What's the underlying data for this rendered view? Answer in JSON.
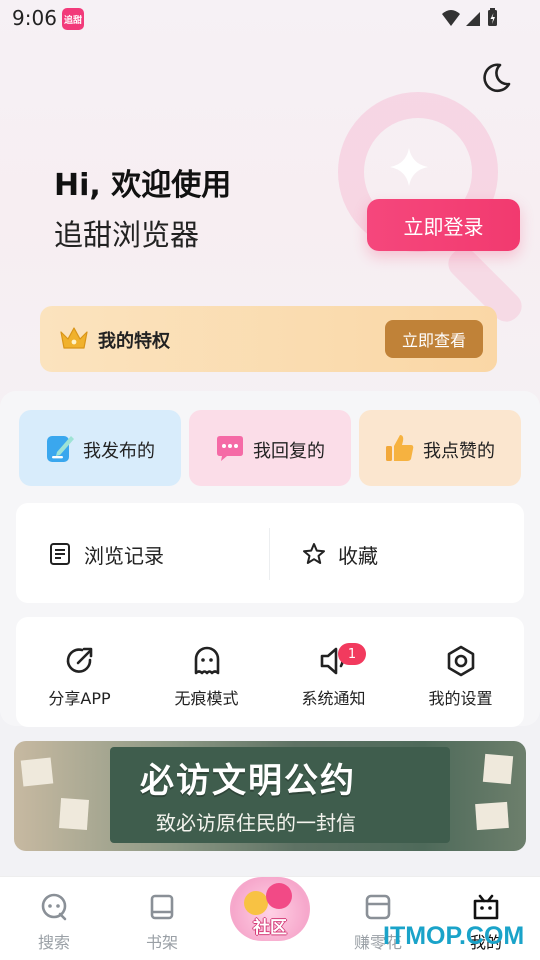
{
  "status_bar": {
    "time": "9:06",
    "app_badge": "追甜"
  },
  "header": {
    "greeting_line1": "Hi, 欢迎使用",
    "greeting_line2": "追甜浏览器",
    "login_label": "立即登录"
  },
  "privilege": {
    "label": "我的特权",
    "button_label": "立即查看"
  },
  "quick_actions": [
    {
      "label": "我发布的",
      "icon": "edit-icon"
    },
    {
      "label": "我回复的",
      "icon": "chat-bubble-icon"
    },
    {
      "label": "我点赞的",
      "icon": "thumbs-up-icon"
    }
  ],
  "history": [
    {
      "label": "浏览记录",
      "icon": "document-icon"
    },
    {
      "label": "收藏",
      "icon": "star-icon"
    }
  ],
  "tools": [
    {
      "label": "分享APP",
      "icon": "share-icon"
    },
    {
      "label": "无痕模式",
      "icon": "ghost-icon"
    },
    {
      "label": "系统通知",
      "icon": "speaker-icon",
      "badge": "1"
    },
    {
      "label": "我的设置",
      "icon": "settings-icon"
    }
  ],
  "banner": {
    "title": "必访文明公约",
    "subtitle": "致必访原住民的一封信"
  },
  "bottom_nav": {
    "items": [
      {
        "label": "搜索",
        "icon": "search-icon"
      },
      {
        "label": "书架",
        "icon": "bookshelf-icon"
      },
      {
        "label": "社区",
        "icon": "community-icon"
      },
      {
        "label": "赚零花",
        "icon": "wallet-icon"
      },
      {
        "label": "我的",
        "icon": "profile-icon"
      }
    ]
  },
  "watermark": "ITMOP.COM",
  "colors": {
    "accent": "#f23a6f",
    "privilege_button": "#c08238",
    "badge": "#f23a5e"
  }
}
